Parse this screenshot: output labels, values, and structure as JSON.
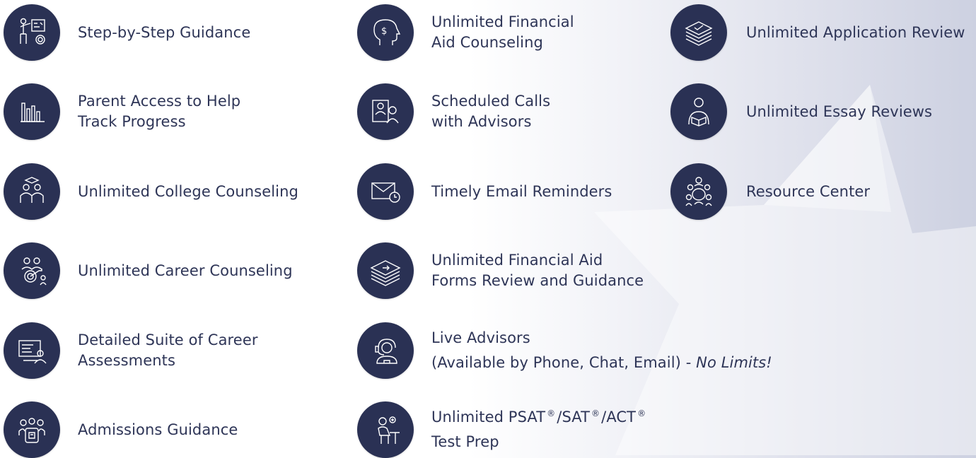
{
  "brand": {
    "navy": "#2a3154",
    "text": "#2e3557",
    "background": "#ffffff"
  },
  "column_1": [
    {
      "label": "Step-by-Step Guidance",
      "icon": "presentation-board-icon"
    },
    {
      "label": "Parent Access to Help",
      "label_line2": "Track Progress",
      "icon": "bar-chart-icon"
    },
    {
      "label": "Unlimited College Counseling",
      "icon": "graduates-icon"
    },
    {
      "label": "Unlimited Career Counseling",
      "icon": "career-target-icon"
    },
    {
      "label": "Detailed Suite of Career",
      "label_line2": "Assessments",
      "icon": "assessment-screen-icon"
    },
    {
      "label": "Admissions Guidance",
      "icon": "admissions-group-icon"
    }
  ],
  "column_2": [
    {
      "label": "Unlimited Financial",
      "label_line2": "Aid Counseling",
      "icon": "dollar-head-icon"
    },
    {
      "label": "Scheduled Calls",
      "label_line2": "with Advisors",
      "icon": "video-call-icon"
    },
    {
      "label": "Timely Email Reminders",
      "icon": "email-clock-icon"
    },
    {
      "label": "Unlimited Financial Aid",
      "label_line2": "Forms Review and Guidance",
      "icon": "forms-stack-icon"
    },
    {
      "label": "Live Advisors",
      "label_line2": "(Available by Phone, Chat, Email) - ",
      "label_line2_emphasis": "No Limits!",
      "icon": "headset-advisor-icon"
    },
    {
      "label_parts": [
        "Unlimited PSAT",
        "®",
        "/SAT",
        "®",
        "/ACT",
        "®"
      ],
      "label_line2": "Test Prep",
      "icon": "student-desk-icon"
    }
  ],
  "column_3": [
    {
      "label": "Unlimited Application Review",
      "icon": "document-stack-icon"
    },
    {
      "label": "Unlimited Essay Reviews",
      "icon": "person-reading-icon"
    },
    {
      "label": "Resource Center",
      "icon": "meeting-table-icon"
    }
  ]
}
